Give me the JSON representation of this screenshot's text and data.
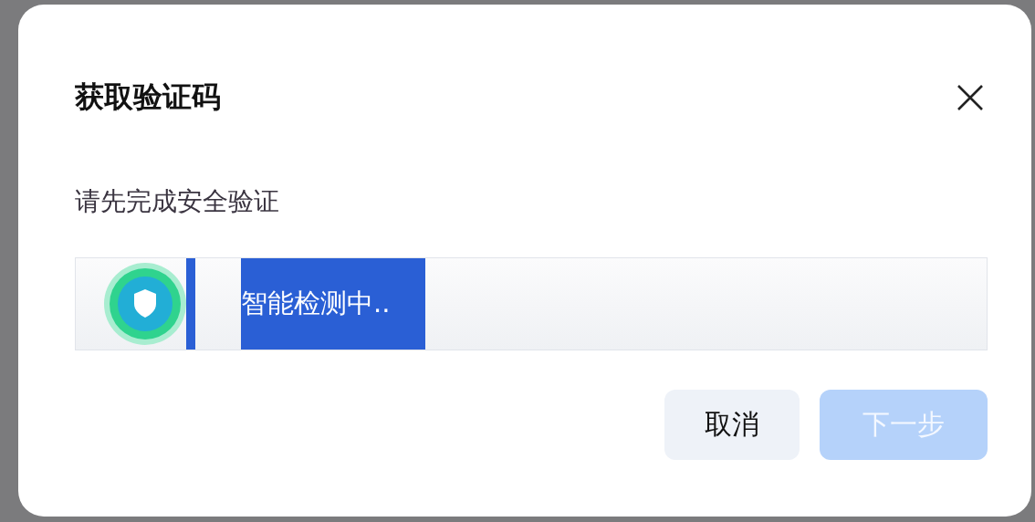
{
  "dialog": {
    "title": "获取验证码",
    "subtitle": "请先完成安全验证",
    "captcha": {
      "status": "智能检测中.."
    },
    "buttons": [
      {
        "label": "取消",
        "kind": "secondary",
        "disabled": false
      },
      {
        "label": "下一步",
        "kind": "primary",
        "disabled": true
      }
    ]
  }
}
